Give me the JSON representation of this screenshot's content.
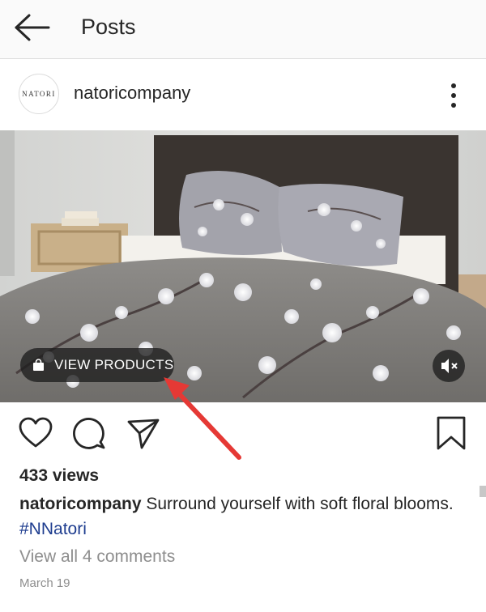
{
  "header": {
    "title": "Posts"
  },
  "post": {
    "avatar_text": "NATORI",
    "username": "natoricompany",
    "view_products_label": "VIEW PRODUCTS",
    "views": "433 views",
    "caption_user": "natoricompany",
    "caption_text": " Surround yourself with soft floral blooms. ",
    "hashtag": "#NNatori",
    "comments_link": "View all 4 comments",
    "date": "March 19"
  },
  "colors": {
    "hashtag": "#1e3d8f",
    "annotation_arrow": "#e53935",
    "muted_text": "#8e8e8e"
  },
  "icons": [
    "back-arrow-icon",
    "more-options-icon",
    "shopping-bag-icon",
    "mute-icon",
    "heart-icon",
    "comment-icon",
    "share-icon",
    "bookmark-icon"
  ]
}
